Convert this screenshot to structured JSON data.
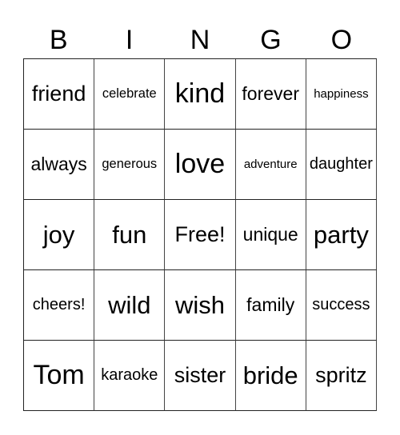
{
  "header": {
    "letters": [
      "B",
      "I",
      "N",
      "G",
      "O"
    ]
  },
  "card": {
    "rows": [
      [
        "friend",
        "celebrate",
        "kind",
        "forever",
        "happiness"
      ],
      [
        "always",
        "generous",
        "love",
        "adventure",
        "daughter"
      ],
      [
        "joy",
        "fun",
        "Free!",
        "unique",
        "party"
      ],
      [
        "cheers!",
        "wild",
        "wish",
        "family",
        "success"
      ],
      [
        "Tom",
        "karaoke",
        "sister",
        "bride",
        "spritz"
      ]
    ]
  }
}
